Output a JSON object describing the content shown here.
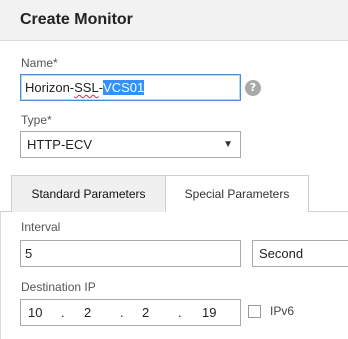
{
  "dialog": {
    "title": "Create Monitor"
  },
  "name_field": {
    "label": "Name*",
    "value_prefix": "Horizon-",
    "value_misspelled": "SSL",
    "value_dash": "-",
    "value_selected": "VCS01"
  },
  "help": {
    "glyph": "?"
  },
  "type_field": {
    "label": "Type*",
    "value": "HTTP-ECV",
    "arrow": "▼"
  },
  "tabs": [
    {
      "label": "Standard Parameters",
      "active": true
    },
    {
      "label": "Special Parameters",
      "active": false
    }
  ],
  "interval": {
    "label": "Interval",
    "value": "5",
    "unit": "Second"
  },
  "destination_ip": {
    "label": "Destination IP",
    "octets": [
      "10",
      "2",
      "2",
      "19"
    ],
    "separator": "."
  },
  "ipv6": {
    "label": "IPv6",
    "checked": false
  },
  "colors": {
    "selection": "#3390ff",
    "focus_border": "#4a90d9",
    "header_bg": "#f2f2f2"
  }
}
